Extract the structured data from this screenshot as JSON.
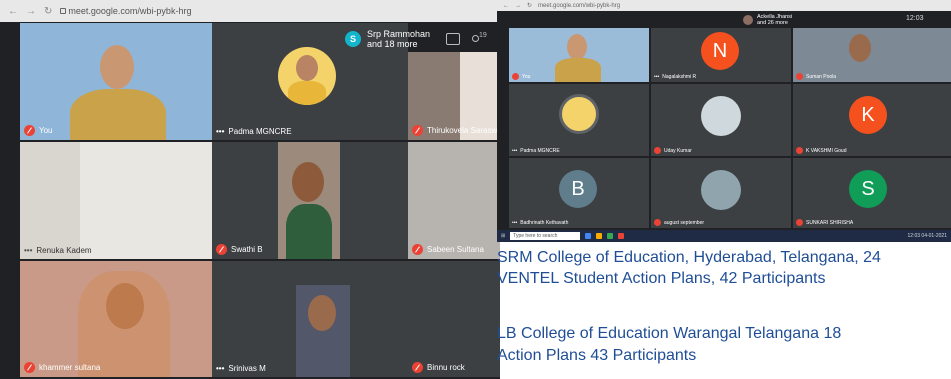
{
  "left_meet": {
    "url": "meet.google.com/wbi-pybk-hrg",
    "participants_summary": {
      "avatar_letter": "S",
      "line1": "Srp Rammohan",
      "line2": "and 18 more",
      "count": "19"
    },
    "tiles": [
      {
        "name": "You"
      },
      {
        "name": "Padma MGNCRE"
      },
      {
        "name": "Thirukovela Saraswathi"
      },
      {
        "name": "Renuka Kadem"
      },
      {
        "name": "Swathi B"
      },
      {
        "name": "Sabeen Sultana"
      },
      {
        "name": "khammer sultana"
      },
      {
        "name": "Srinivas M"
      },
      {
        "name": "Binnu rock"
      }
    ]
  },
  "right_meet": {
    "url": "meet.google.com/wbi-pybk-hrg",
    "participants_summary": {
      "line1": "Ackella Jhansi",
      "line2": "and 26 more"
    },
    "clock": "12:03",
    "tiles": [
      {
        "name": "You"
      },
      {
        "name": "Nagalakshmi R",
        "initial": "N",
        "color": "#f4511e"
      },
      {
        "name": "Suman Poola"
      },
      {
        "name": "Padma MGNCRE"
      },
      {
        "name": "Uday Kumar"
      },
      {
        "name": "K VAKSHMI Goud",
        "initial": "K",
        "color": "#f4511e"
      },
      {
        "name": "Badhrinath Kethavath",
        "initial": "B",
        "color": "#607d8b"
      },
      {
        "name": "august september"
      },
      {
        "name": "SUNKARI SHIRISHA",
        "initial": "S",
        "color": "#0f9d58"
      }
    ],
    "taskbar": {
      "search_placeholder": "Type here to search",
      "time": "12:03",
      "date": "04-01-2021"
    }
  },
  "captions": [
    "SRM College of Education, Hyderabad, Telangana, 24",
    "VENTEL Student Action Plans, 42 Participants",
    "LB College of Education Warangal Telangana 18",
    "Action Plans  43 Participants"
  ]
}
